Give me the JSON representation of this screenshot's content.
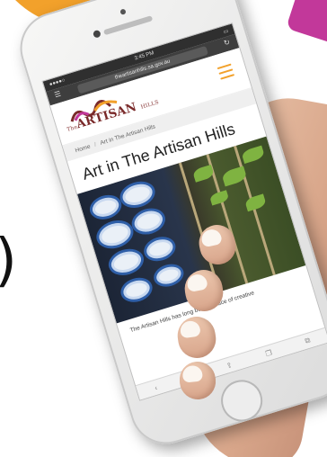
{
  "site": {
    "status_time": "3:45 PM",
    "url": "theartisanhills.sa.gov.au",
    "logo_prefix": "The",
    "logo_main": "ARTISAN",
    "logo_suffix": "HILLS",
    "breadcrumb": [
      "Home",
      "Art in The Artisan Hills"
    ],
    "title": "Art in The Artisan Hills",
    "body_text": "The Artisan Hills has long been a place of creative"
  },
  "colors": {
    "accent_orange": "#f2a12b",
    "accent_purple": "#c2389a",
    "logo_text": "#7a2a2a"
  },
  "icons": {
    "menu": "hamburger-icon",
    "reload": "reload-icon",
    "back": "back-icon",
    "forward": "forward-icon",
    "share": "share-icon",
    "bookmarks": "bookmarks-icon",
    "tabs": "tabs-icon"
  }
}
